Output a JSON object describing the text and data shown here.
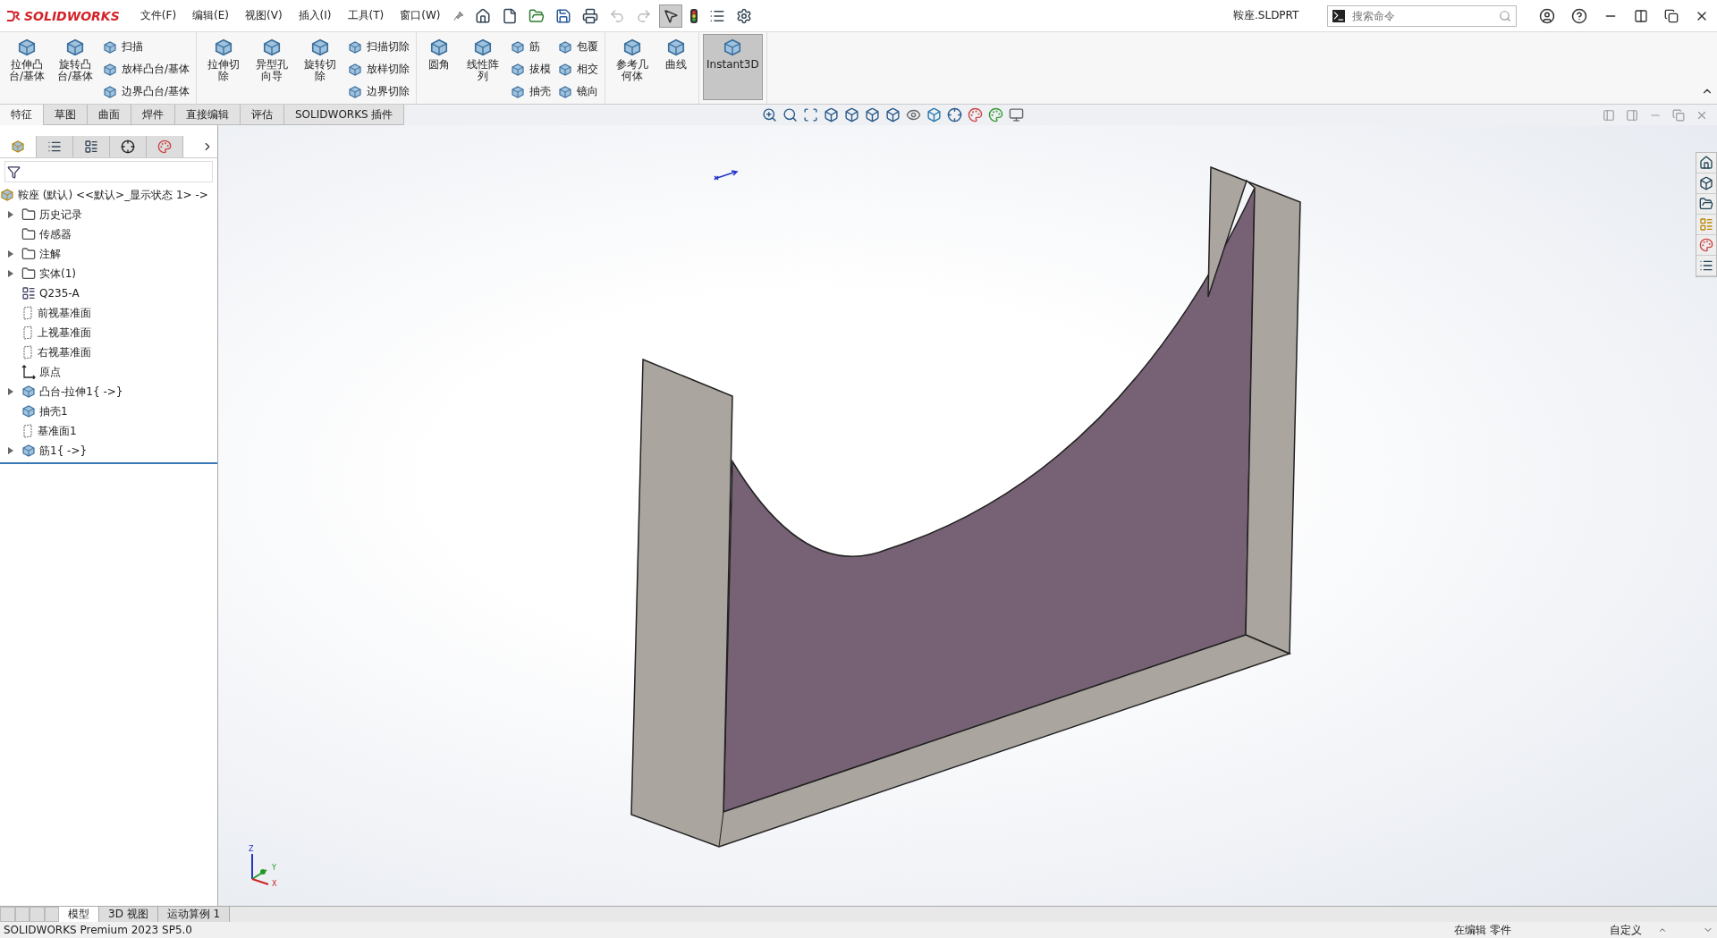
{
  "title_bar": {
    "logo": "SOLIDWORKS",
    "menus": [
      "文件(F)",
      "编辑(E)",
      "视图(V)",
      "插入(I)",
      "工具(T)",
      "窗口(W)"
    ],
    "document_title": "鞍座.SLDPRT",
    "search": {
      "placeholder": "搜索命令"
    }
  },
  "ribbon": {
    "groups": [
      {
        "items": [
          {
            "kind": "large",
            "label": "拉伸凸台/基体",
            "selected": false
          },
          {
            "kind": "large",
            "label": "旋转凸台/基体",
            "selected": false
          },
          {
            "kind": "small",
            "label": "扫描",
            "selected": false
          },
          {
            "kind": "small",
            "label": "放样凸台/基体",
            "selected": false
          },
          {
            "kind": "small",
            "label": "边界凸台/基体",
            "selected": false
          }
        ]
      },
      {
        "items": [
          {
            "kind": "large",
            "label": "拉伸切除",
            "selected": false
          },
          {
            "kind": "large",
            "label": "异型孔向导",
            "selected": false
          },
          {
            "kind": "large",
            "label": "旋转切除",
            "selected": false
          },
          {
            "kind": "small",
            "label": "扫描切除",
            "selected": false
          },
          {
            "kind": "small",
            "label": "放样切除",
            "selected": false
          },
          {
            "kind": "small",
            "label": "边界切除",
            "selected": false
          }
        ]
      },
      {
        "items": [
          {
            "kind": "large",
            "label": "圆角",
            "selected": false
          },
          {
            "kind": "large",
            "label": "线性阵列",
            "selected": false
          },
          {
            "kind": "small",
            "label": "筋",
            "selected": false
          },
          {
            "kind": "small",
            "label": "拔模",
            "selected": false
          },
          {
            "kind": "small",
            "label": "抽壳",
            "selected": false
          },
          {
            "kind": "small",
            "label": "包覆",
            "selected": false
          },
          {
            "kind": "small",
            "label": "相交",
            "selected": false
          },
          {
            "kind": "small",
            "label": "镜向",
            "selected": false
          }
        ]
      },
      {
        "items": [
          {
            "kind": "large",
            "label": "参考几何体",
            "selected": false
          },
          {
            "kind": "large",
            "label": "曲线",
            "selected": false
          }
        ]
      },
      {
        "items": [
          {
            "kind": "toggle",
            "label": "Instant3D",
            "selected": true
          }
        ]
      }
    ]
  },
  "command_tabs": [
    {
      "label": "特征",
      "selected": true
    },
    {
      "label": "草图",
      "selected": false
    },
    {
      "label": "曲面",
      "selected": false
    },
    {
      "label": "焊件",
      "selected": false
    },
    {
      "label": "直接编辑",
      "selected": false
    },
    {
      "label": "评估",
      "selected": false
    },
    {
      "label": "SOLIDWORKS 插件",
      "selected": false
    }
  ],
  "feature_tree": {
    "root": "鞍座 (默认) <<默认>_显示状态 1> ->",
    "items": [
      {
        "label": "历史记录",
        "kind": "folder",
        "expandable": true
      },
      {
        "label": "传感器",
        "kind": "folder",
        "expandable": false
      },
      {
        "label": "注解",
        "kind": "folder",
        "expandable": true
      },
      {
        "label": "实体(1)",
        "kind": "folder",
        "expandable": true
      },
      {
        "label": "Q235-A",
        "kind": "material",
        "expandable": false
      },
      {
        "label": "前视基准面",
        "kind": "plane",
        "expandable": false
      },
      {
        "label": "上视基准面",
        "kind": "plane",
        "expandable": false
      },
      {
        "label": "右视基准面",
        "kind": "plane",
        "expandable": false
      },
      {
        "label": "原点",
        "kind": "origin",
        "expandable": false
      },
      {
        "label": "凸台-拉伸1{ ->}",
        "kind": "feature",
        "expandable": true
      },
      {
        "label": "抽壳1",
        "kind": "feature",
        "expandable": false
      },
      {
        "label": "基准面1",
        "kind": "plane",
        "expandable": false
      },
      {
        "label": "筋1{ ->}",
        "kind": "feature",
        "expandable": true
      }
    ]
  },
  "triad": {
    "x": "X",
    "y": "Y",
    "z": "Z"
  },
  "bottom_tabs": [
    {
      "label": "模型",
      "selected": true
    },
    {
      "label": "3D 视图",
      "selected": false
    },
    {
      "label": "运动算例 1",
      "selected": false
    }
  ],
  "status_bar": {
    "version": "SOLIDWORKS Premium 2023 SP5.0",
    "mode": "在编辑 零件",
    "units": "自定义"
  }
}
